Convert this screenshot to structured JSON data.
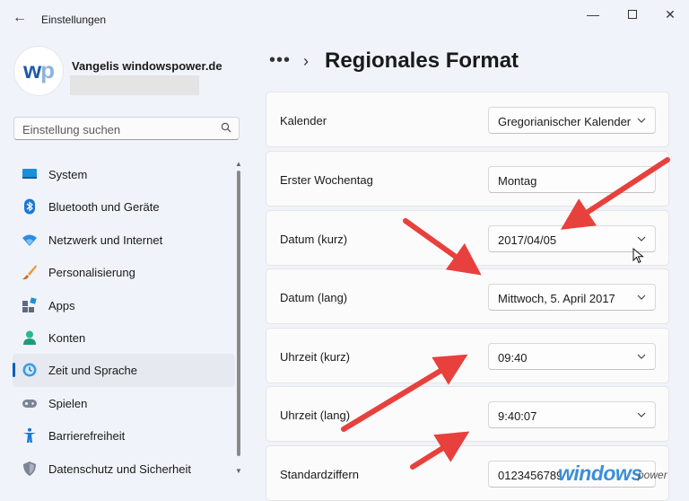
{
  "window": {
    "title": "Einstellungen"
  },
  "profile": {
    "avatar_text_a": "w",
    "avatar_text_b": "p",
    "name": "Vangelis windowspower.de"
  },
  "search": {
    "placeholder": "Einstellung suchen"
  },
  "nav": {
    "items": [
      {
        "label": "System",
        "icon": "system-icon"
      },
      {
        "label": "Bluetooth und Geräte",
        "icon": "bluetooth-icon"
      },
      {
        "label": "Netzwerk und Internet",
        "icon": "wifi-icon"
      },
      {
        "label": "Personalisierung",
        "icon": "brush-icon"
      },
      {
        "label": "Apps",
        "icon": "apps-icon"
      },
      {
        "label": "Konten",
        "icon": "account-icon"
      },
      {
        "label": "Zeit und Sprache",
        "icon": "time-language-icon",
        "active": true
      },
      {
        "label": "Spielen",
        "icon": "gamepad-icon"
      },
      {
        "label": "Barrierefreiheit",
        "icon": "accessibility-icon"
      },
      {
        "label": "Datenschutz und Sicherheit",
        "icon": "shield-icon"
      }
    ]
  },
  "header": {
    "dots": "•••",
    "chevron": "›",
    "title": "Regionales Format"
  },
  "settings": [
    {
      "label": "Kalender",
      "value": "Gregorianischer Kalender"
    },
    {
      "label": "Erster Wochentag",
      "value": "Montag"
    },
    {
      "label": "Datum (kurz)",
      "value": "2017/04/05"
    },
    {
      "label": "Datum (lang)",
      "value": "Mittwoch, 5. April 2017"
    },
    {
      "label": "Uhrzeit (kurz)",
      "value": "09:40"
    },
    {
      "label": "Uhrzeit (lang)",
      "value": "9:40:07"
    },
    {
      "label": "Standardziffern",
      "value": "0123456789"
    }
  ],
  "watermark": {
    "text": "windows",
    "sub": "power"
  },
  "colors": {
    "accent": "#005fb8",
    "arrow": "#e8403c",
    "background": "#f0f3f9"
  }
}
